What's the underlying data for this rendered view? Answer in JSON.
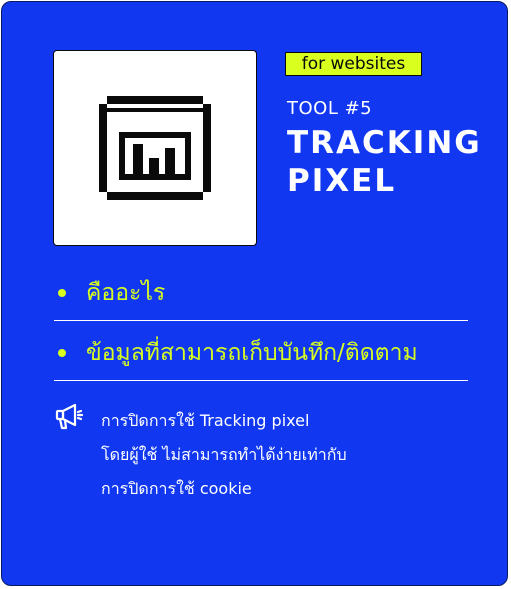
{
  "tag": "for websites",
  "tool_number": "TOOL #5",
  "title_line1": "TRACKING",
  "title_line2": "PIXEL",
  "bullets": [
    "คืออะไร",
    "ข้อมูลที่สามารถเก็บบันทึก/ติดตาม"
  ],
  "note": {
    "icon": "megaphone-icon",
    "lines": [
      "การปิดการใช้ Tracking pixel",
      "โดยผู้ใช้ ไม่สามารถทำได้ง่ายเท่ากับ",
      "การปิดการใช้ cookie"
    ]
  },
  "colors": {
    "background": "#1138f0",
    "accent": "#d8ff1e",
    "text": "#ffffff"
  },
  "main_icon": "tracking-pixel-chart-window-icon"
}
